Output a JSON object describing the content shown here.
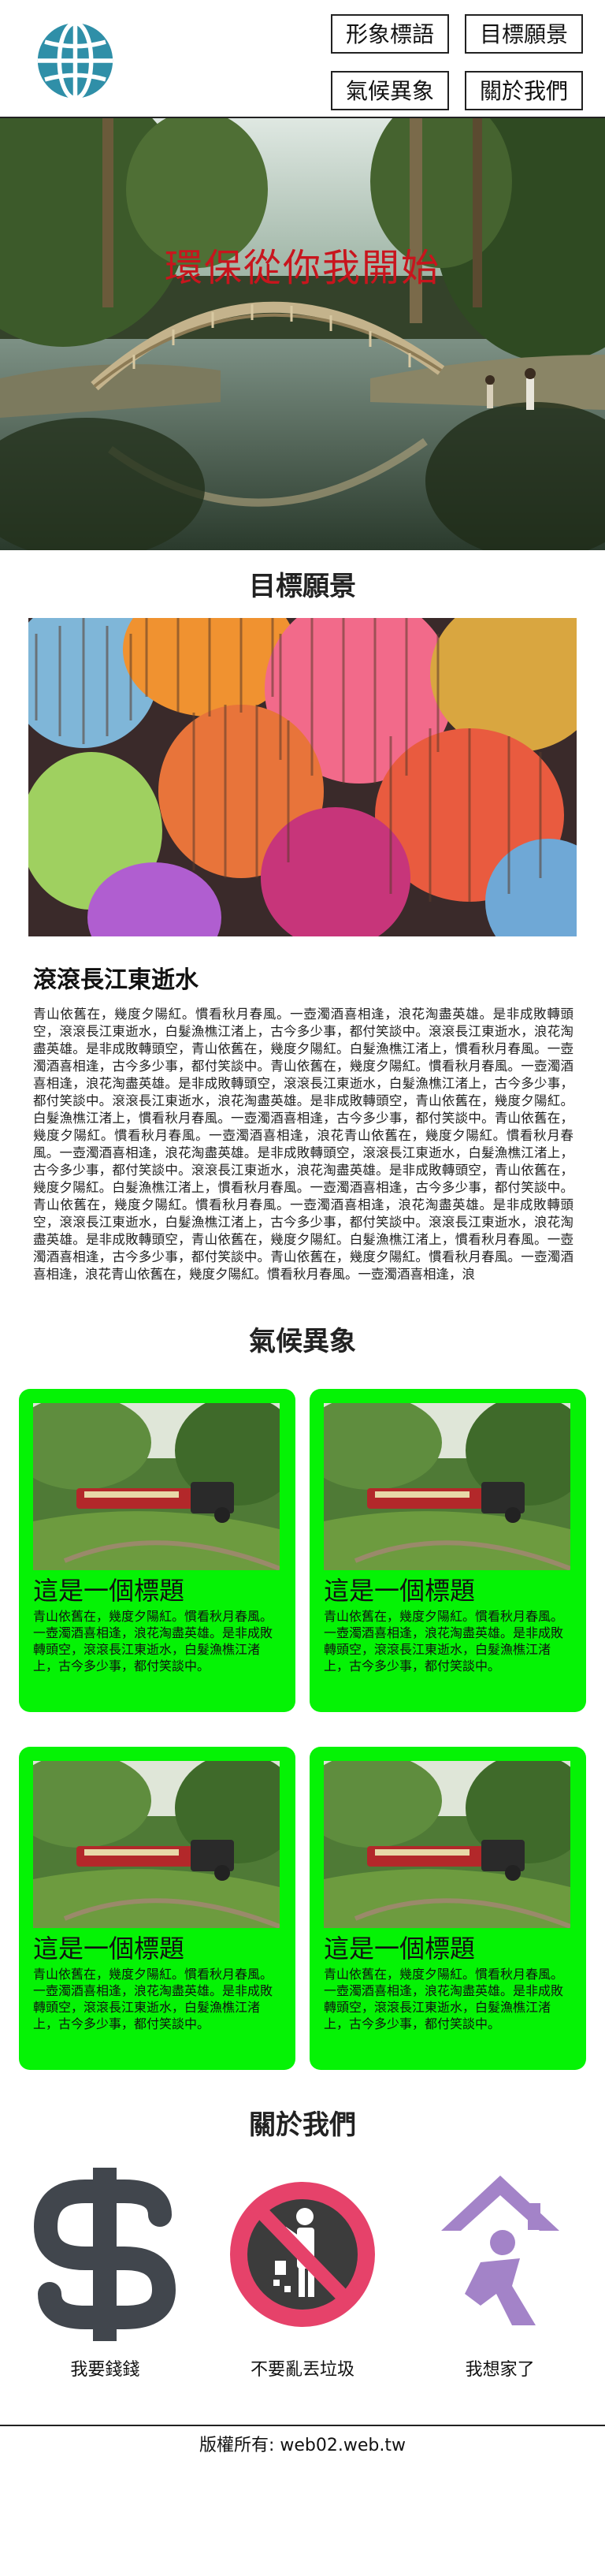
{
  "nav": {
    "items": [
      "形象標語",
      "目標願景",
      "氣候異象",
      "關於我們"
    ]
  },
  "hero": {
    "title": "環保從你我開始"
  },
  "goals": {
    "title": "目標願景",
    "heading": "滾滾長江東逝水",
    "body": "青山依舊在，幾度夕陽紅。慣看秋月春風。一壺濁酒喜相逢，浪花淘盡英雄。是非成敗轉頭空，滾滾長江東逝水，白髮漁樵江渚上，古今多少事，都付笑談中。滾滾長江東逝水，浪花淘盡英雄。是非成敗轉頭空，青山依舊在，幾度夕陽紅。白髮漁樵江渚上，慣看秋月春風。一壺濁酒喜相逢，古今多少事，都付笑談中。青山依舊在，幾度夕陽紅。慣看秋月春風。一壺濁酒喜相逢，浪花淘盡英雄。是非成敗轉頭空，滾滾長江東逝水，白髮漁樵江渚上，古今多少事，都付笑談中。滾滾長江東逝水，浪花淘盡英雄。是非成敗轉頭空，青山依舊在，幾度夕陽紅。白髮漁樵江渚上，慣看秋月春風。一壺濁酒喜相逢，古今多少事，都付笑談中。青山依舊在，幾度夕陽紅。慣看秋月春風。一壺濁酒喜相逢，浪花青山依舊在，幾度夕陽紅。慣看秋月春風。一壺濁酒喜相逢，浪花淘盡英雄。是非成敗轉頭空，滾滾長江東逝水，白髮漁樵江渚上，古今多少事，都付笑談中。滾滾長江東逝水，浪花淘盡英雄。是非成敗轉頭空，青山依舊在，幾度夕陽紅。白髮漁樵江渚上，慣看秋月春風。一壺濁酒喜相逢，古今多少事，都付笑談中。青山依舊在，幾度夕陽紅。慣看秋月春風。一壺濁酒喜相逢，浪花淘盡英雄。是非成敗轉頭空，滾滾長江東逝水，白髮漁樵江渚上，古今多少事，都付笑談中。滾滾長江東逝水，浪花淘盡英雄。是非成敗轉頭空，青山依舊在，幾度夕陽紅。白髮漁樵江渚上，慣看秋月春風。一壺濁酒喜相逢，古今多少事，都付笑談中。青山依舊在，幾度夕陽紅。慣看秋月春風。一壺濁酒喜相逢，浪花青山依舊在，幾度夕陽紅。慣看秋月春風。一壺濁酒喜相逢，浪"
  },
  "climate": {
    "title": "氣候異象",
    "cards": [
      {
        "title": "這是一個標題",
        "text": "青山依舊在，幾度夕陽紅。慣看秋月春風。一壺濁酒喜相逢，浪花淘盡英雄。是非成敗轉頭空，滾滾長江東逝水，白髮漁樵江渚上，古今多少事，都付笑談中。"
      },
      {
        "title": "這是一個標題",
        "text": "青山依舊在，幾度夕陽紅。慣看秋月春風。一壺濁酒喜相逢，浪花淘盡英雄。是非成敗轉頭空，滾滾長江東逝水，白髮漁樵江渚上，古今多少事，都付笑談中。"
      },
      {
        "title": "這是一個標題",
        "text": "青山依舊在，幾度夕陽紅。慣看秋月春風。一壺濁酒喜相逢，浪花淘盡英雄。是非成敗轉頭空，滾滾長江東逝水，白髮漁樵江渚上，古今多少事，都付笑談中。"
      },
      {
        "title": "這是一個標題",
        "text": "青山依舊在，幾度夕陽紅。慣看秋月春風。一壺濁酒喜相逢，浪花淘盡英雄。是非成敗轉頭空，滾滾長江東逝水，白髮漁樵江渚上，古今多少事，都付笑談中。"
      }
    ]
  },
  "about": {
    "title": "關於我們",
    "items": [
      {
        "label": "我要錢錢",
        "icon": "dollar-icon"
      },
      {
        "label": "不要亂丟垃圾",
        "icon": "no-littering-icon"
      },
      {
        "label": "我想家了",
        "icon": "home-person-icon"
      }
    ]
  },
  "footer": {
    "text": "版權所有: web02.web.tw"
  },
  "colors": {
    "card_bg": "#05f305",
    "hero_title": "#c8151d",
    "globe": "#2f8fa8",
    "dollar": "#41464d",
    "no_litter_ring": "#e6426a",
    "home_person": "#a383c8"
  }
}
